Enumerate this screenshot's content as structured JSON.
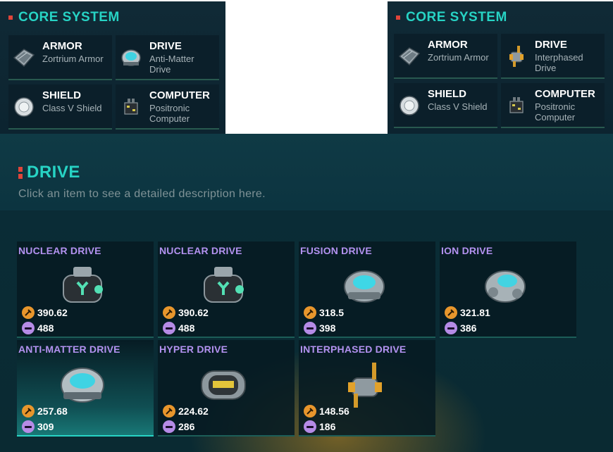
{
  "core_left": {
    "title": "CORE SYSTEM",
    "slots": [
      {
        "name": "ARMOR",
        "item": "Zortrium Armor",
        "icon": "armor-icon"
      },
      {
        "name": "DRIVE",
        "item": "Anti-Matter Drive",
        "icon": "anti-matter-drive-icon"
      },
      {
        "name": "SHIELD",
        "item": "Class V Shield",
        "icon": "shield-icon"
      },
      {
        "name": "COMPUTER",
        "item": "Positronic Computer",
        "icon": "computer-icon"
      }
    ]
  },
  "core_right": {
    "title": "CORE SYSTEM",
    "slots": [
      {
        "name": "ARMOR",
        "item": "Zortrium Armor",
        "icon": "armor-icon"
      },
      {
        "name": "DRIVE",
        "item": "Interphased Drive",
        "icon": "interphased-drive-icon"
      },
      {
        "name": "SHIELD",
        "item": "Class V Shield",
        "icon": "shield-icon"
      },
      {
        "name": "COMPUTER",
        "item": "Positronic Computer",
        "icon": "computer-icon"
      }
    ]
  },
  "drive_panel": {
    "title": "DRIVE",
    "description": "Click an item to see a detailed description here.",
    "items": [
      {
        "name": "NUCLEAR DRIVE",
        "power": "390.62",
        "weight": "488",
        "art": "nuclear-drive-icon"
      },
      {
        "name": "NUCLEAR DRIVE",
        "power": "390.62",
        "weight": "488",
        "art": "nuclear-drive-icon"
      },
      {
        "name": "FUSION DRIVE",
        "power": "318.5",
        "weight": "398",
        "art": "fusion-drive-icon"
      },
      {
        "name": "ION DRIVE",
        "power": "321.81",
        "weight": "386",
        "art": "ion-drive-icon"
      },
      {
        "name": "ANTI-MATTER DRIVE",
        "power": "257.68",
        "weight": "309",
        "art": "anti-matter-drive-icon",
        "selected": true
      },
      {
        "name": "HYPER DRIVE",
        "power": "224.62",
        "weight": "286",
        "art": "hyper-drive-icon"
      },
      {
        "name": "INTERPHASED DRIVE",
        "power": "148.56",
        "weight": "186",
        "art": "interphased-drive-icon"
      }
    ]
  },
  "colors": {
    "accent_teal": "#27d3c4",
    "title_marker": "#e0453a",
    "item_name": "#b392f0",
    "power_icon": "#e8962c",
    "weight_icon": "#b58be6"
  }
}
